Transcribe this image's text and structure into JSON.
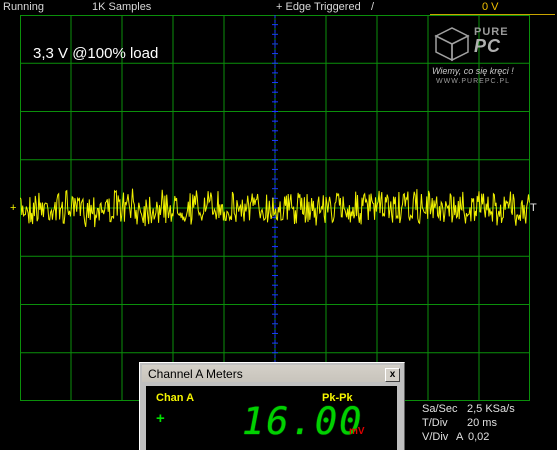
{
  "topbar": {
    "state": "Running",
    "samples": "1K Samples",
    "trigger": "+ Edge Triggered",
    "trigger_glyph": "/",
    "trigger_level": "0 V"
  },
  "overlay": {
    "label": "3,3 V @100% load",
    "trigger_marker": "T",
    "channel_marker": "+"
  },
  "logo": {
    "brand_top": "PURE",
    "brand_main": "PC",
    "tagline": "Wiemy, co się kręci !",
    "url": "WWW.PUREPC.PL"
  },
  "meter": {
    "title": "Channel A Meters",
    "close": "x",
    "channel": "Chan A",
    "measurement": "Pk-Pk",
    "sign": "+",
    "value": "16.00",
    "unit": "mV"
  },
  "settings": {
    "sa_sec_label": "Sa/Sec",
    "sa_sec_value": "2,5 KSa/s",
    "t_div_label": "T/Div",
    "t_div_value": "20 ms",
    "v_div_label": "V/Div",
    "v_div_channel": "A",
    "v_div_value": "0,02"
  },
  "colors": {
    "grid": "#0b8f0b",
    "trace": "#f0f000",
    "center_axis": "#1a3cff",
    "meter_digits": "#00d000",
    "unit": "#e00000"
  },
  "chart_data": {
    "type": "line",
    "title": "",
    "xlabel": "",
    "ylabel": "",
    "grid": true,
    "x_divisions": 10,
    "y_divisions": 8,
    "series": [
      {
        "pk_pk_mV": 16.0,
        "offset_V": 0
      }
    ]
  }
}
